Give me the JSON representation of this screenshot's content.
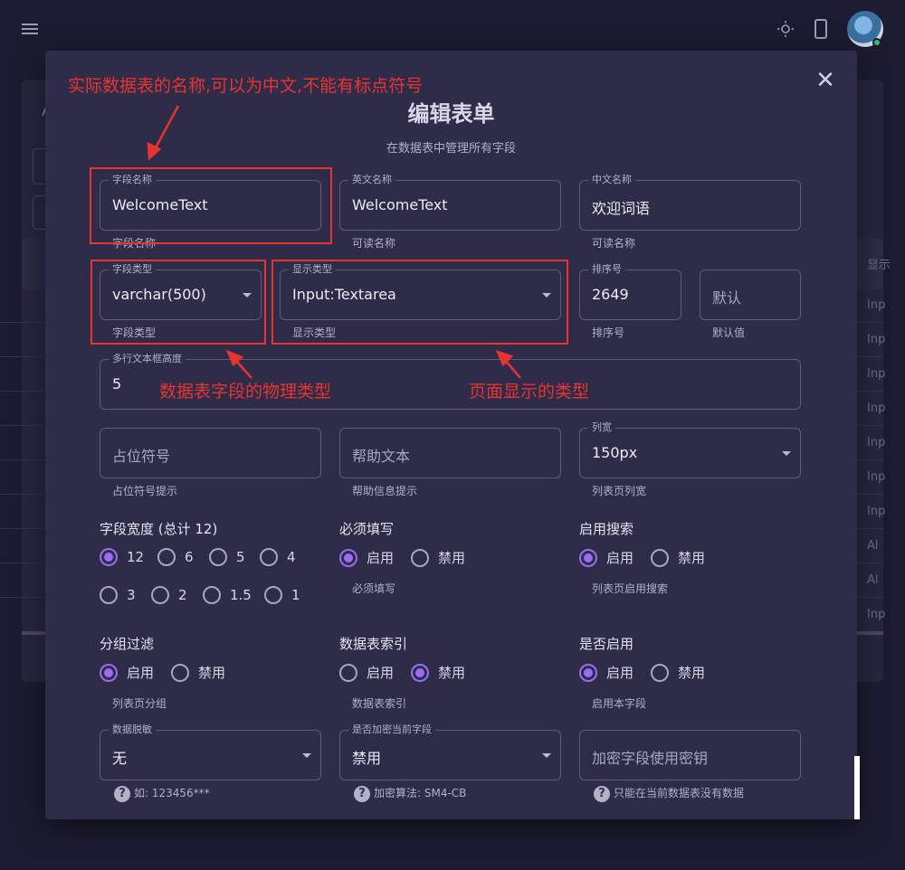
{
  "header": {
    "menu_icon": "hamburger-icon",
    "theme_icon": "sun-icon",
    "device_icon": "phone-icon",
    "avatar": "user-avatar"
  },
  "background_table": {
    "title_partial": "A",
    "column_partial": "显示",
    "row_values": [
      "Inp",
      "Inp",
      "Inp",
      "Inp",
      "Inp",
      "Inp",
      "Inp",
      "Al",
      "Al",
      "Inp"
    ]
  },
  "modal": {
    "title": "编辑表单",
    "subtitle": "在数据表中管理所有字段",
    "close_label": "✕",
    "fields": {
      "field_name": {
        "label": "字段名称",
        "value": "WelcomeText",
        "hint": "字段名称"
      },
      "english_name": {
        "label": "英文名称",
        "value": "WelcomeText",
        "hint": "可读名称"
      },
      "chinese_name": {
        "label": "中文名称",
        "value": "欢迎词语",
        "hint": "可读名称"
      },
      "field_type": {
        "label": "字段类型",
        "value": "varchar(500)",
        "hint": "字段类型"
      },
      "display_type": {
        "label": "显示类型",
        "value": "Input:Textarea",
        "hint": "显示类型"
      },
      "sort_order": {
        "label": "排序号",
        "value": "2649",
        "hint": "排序号"
      },
      "default_value": {
        "placeholder": "默认",
        "hint": "默认值"
      },
      "textarea_height": {
        "label": "多行文本框高度",
        "value": "5"
      },
      "placeholder": {
        "placeholder": "占位符号",
        "hint": "占位符号提示"
      },
      "help_text": {
        "placeholder": "帮助文本",
        "hint": "帮助信息提示"
      },
      "column_width": {
        "label": "列宽",
        "value": "150px",
        "hint": "列表页列宽"
      },
      "masking": {
        "label": "数据脱敏",
        "value": "无",
        "hint": "如: 123456***"
      },
      "encrypt_field": {
        "label": "是否加密当前字段",
        "value": "禁用",
        "hint": "加密算法: SM4-CB"
      },
      "encrypt_key": {
        "placeholder": "加密字段使用密钥",
        "hint": "只能在当前数据表没有数据"
      }
    },
    "field_width": {
      "title": "字段宽度 (总计 12)",
      "options": [
        "12",
        "6",
        "5",
        "4",
        "3",
        "2",
        "1.5",
        "1"
      ],
      "selected": "12"
    },
    "required": {
      "title": "必须填写",
      "on": "启用",
      "off": "禁用",
      "selected": "启用",
      "hint": "必须填写"
    },
    "search": {
      "title": "启用搜索",
      "on": "启用",
      "off": "禁用",
      "selected": "启用",
      "hint": "列表页启用搜索"
    },
    "group_filter": {
      "title": "分组过滤",
      "on": "启用",
      "off": "禁用",
      "selected": "启用",
      "hint": "列表页分组"
    },
    "table_index": {
      "title": "数据表索引",
      "on": "启用",
      "off": "禁用",
      "selected": "禁用",
      "hint": "数据表索引"
    },
    "enabled": {
      "title": "是否启用",
      "on": "启用",
      "off": "禁用",
      "selected": "启用",
      "hint": "启用本字段"
    }
  },
  "annotations": {
    "table_name_note": "实际数据表的名称,可以为中文,不能有标点符号",
    "physical_type_note": "数据表字段的物理类型",
    "display_type_note": "页面显示的类型",
    "color": "#e8342f"
  },
  "colors": {
    "background": "#1d1b31",
    "modal": "#2f2c4a",
    "accent": "#9b6cf2"
  }
}
